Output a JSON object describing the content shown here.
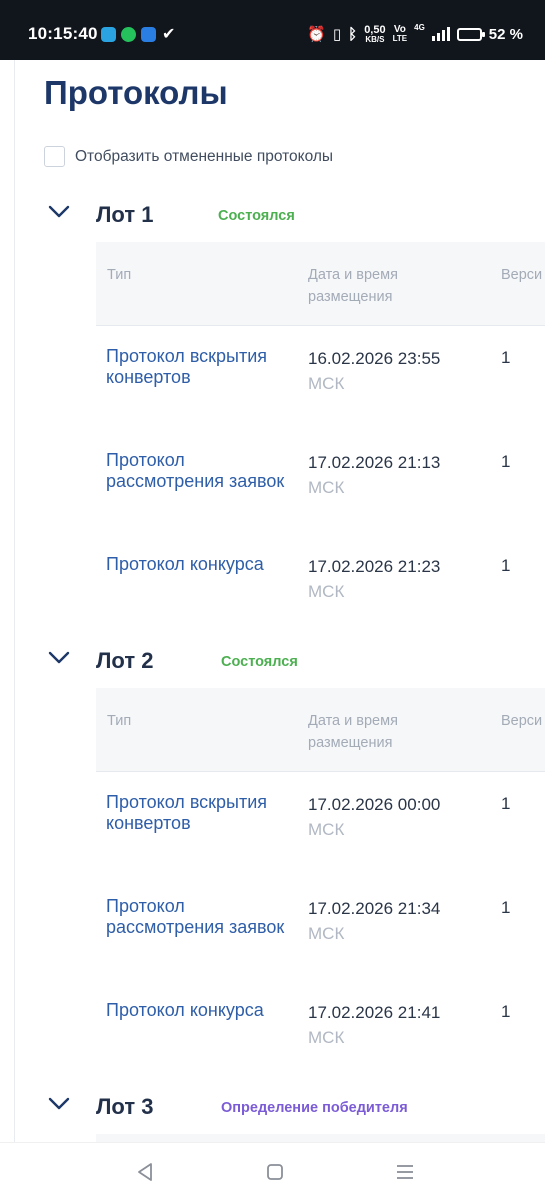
{
  "status_bar": {
    "time": "10:15:40",
    "net_speed_value": "0,50",
    "net_speed_unit": "KB/S",
    "volte_top": "Vo",
    "volte_bottom": "LTE",
    "network": "4G",
    "battery": "52 %",
    "battery_level": 0.52
  },
  "page": {
    "title": "Протоколы",
    "show_cancelled_label": "Отобразить отмененные протоколы",
    "show_cancelled_checked": false
  },
  "table_headers": {
    "type": "Тип",
    "date": "Дата и время размещения",
    "version": "Верси"
  },
  "lots": [
    {
      "title": "Лот 1",
      "status": "Состоялся",
      "status_color": "#4caf50",
      "rows": [
        {
          "type": "Протокол вскрытия конвертов",
          "date": "16.02.2026 23:55",
          "tz": "МСК",
          "version": "1"
        },
        {
          "type": "Протокол рассмотрения заявок",
          "date": "17.02.2026 21:13",
          "tz": "МСК",
          "version": "1"
        },
        {
          "type": "Протокол конкурса",
          "date": "17.02.2026 21:23",
          "tz": "МСК",
          "version": "1"
        }
      ]
    },
    {
      "title": "Лот 2",
      "status": "Состоялся",
      "status_color": "#4caf50",
      "rows": [
        {
          "type": "Протокол вскрытия конвертов",
          "date": "17.02.2026 00:00",
          "tz": "МСК",
          "version": "1"
        },
        {
          "type": "Протокол рассмотрения заявок",
          "date": "17.02.2026 21:34",
          "tz": "МСК",
          "version": "1"
        },
        {
          "type": "Протокол конкурса",
          "date": "17.02.2026 21:41",
          "tz": "МСК",
          "version": "1"
        }
      ]
    },
    {
      "title": "Лот 3",
      "status": "Определение победителя",
      "status_color": "#7b5cd6"
    }
  ]
}
